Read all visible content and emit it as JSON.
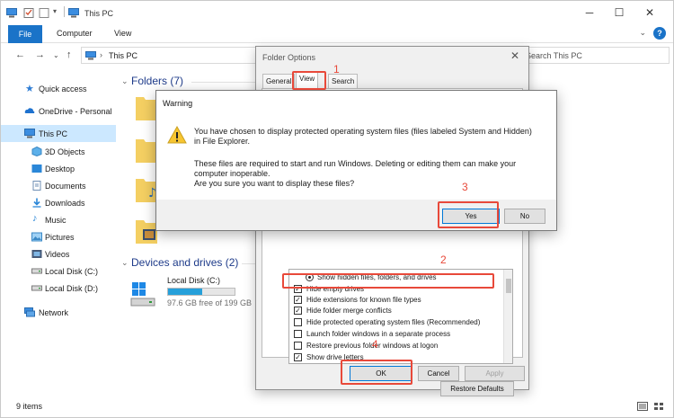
{
  "window": {
    "title": "This PC",
    "ribbon_tabs": [
      "File",
      "Computer",
      "View"
    ]
  },
  "address": {
    "path": "This PC",
    "search_placeholder": "Search This PC"
  },
  "nav_pane": {
    "items": [
      {
        "label": "Quick access",
        "icon": "star-icon"
      },
      {
        "label": "OneDrive - Personal",
        "icon": "cloud-icon"
      },
      {
        "label": "This PC",
        "icon": "computer-icon"
      },
      {
        "label": "3D Objects",
        "icon": "cube-icon"
      },
      {
        "label": "Desktop",
        "icon": "desktop-icon"
      },
      {
        "label": "Documents",
        "icon": "document-icon"
      },
      {
        "label": "Downloads",
        "icon": "download-icon"
      },
      {
        "label": "Music",
        "icon": "music-icon"
      },
      {
        "label": "Pictures",
        "icon": "picture-icon"
      },
      {
        "label": "Videos",
        "icon": "video-icon"
      },
      {
        "label": "Local Disk (C:)",
        "icon": "drive-icon"
      },
      {
        "label": "Local Disk (D:)",
        "icon": "drive-icon"
      },
      {
        "label": "Network",
        "icon": "network-icon"
      }
    ]
  },
  "content": {
    "folders_header": "Folders (7)",
    "drives_header": "Devices and drives (2)",
    "drive": {
      "name": "Local Disk (C:)",
      "free": "97.6 GB free of 199 GB",
      "used_fraction": 0.51
    }
  },
  "status": {
    "items_count": "9 items"
  },
  "folder_options": {
    "title": "Folder Options",
    "tabs": [
      "General",
      "View",
      "Search"
    ],
    "settings": [
      {
        "label": "Show hidden files, folders, and drives",
        "type": "radio",
        "checked": true
      },
      {
        "label": "Hide empty drives",
        "type": "checkbox",
        "checked": true
      },
      {
        "label": "Hide extensions for known file types",
        "type": "checkbox",
        "checked": true
      },
      {
        "label": "Hide folder merge conflicts",
        "type": "checkbox",
        "checked": true
      },
      {
        "label": "Hide protected operating system files (Recommended)",
        "type": "checkbox",
        "checked": false
      },
      {
        "label": "Launch folder windows in a separate process",
        "type": "checkbox",
        "checked": false
      },
      {
        "label": "Restore previous folder windows at logon",
        "type": "checkbox",
        "checked": false
      },
      {
        "label": "Show drive letters",
        "type": "checkbox",
        "checked": true
      }
    ],
    "restore_defaults": "Restore Defaults",
    "ok": "OK",
    "cancel": "Cancel",
    "apply": "Apply"
  },
  "warning": {
    "title": "Warning",
    "line1": "You have chosen to display protected operating system files (files labeled System and Hidden)",
    "line2": "in File Explorer.",
    "line3": "These files are required to start and run Windows. Deleting or editing them can make your",
    "line4": "computer inoperable.",
    "line5": "Are you sure you want to display these files?",
    "yes": "Yes",
    "no": "No"
  },
  "annotations": {
    "step1": "1",
    "step2": "2",
    "step3": "3",
    "step4": "4",
    "color": "#e8493a"
  },
  "colors": {
    "accent": "#1a73c8",
    "selection": "#cce8ff",
    "drive_bar": "#26a0da",
    "section_header": "#1e3b8a"
  }
}
